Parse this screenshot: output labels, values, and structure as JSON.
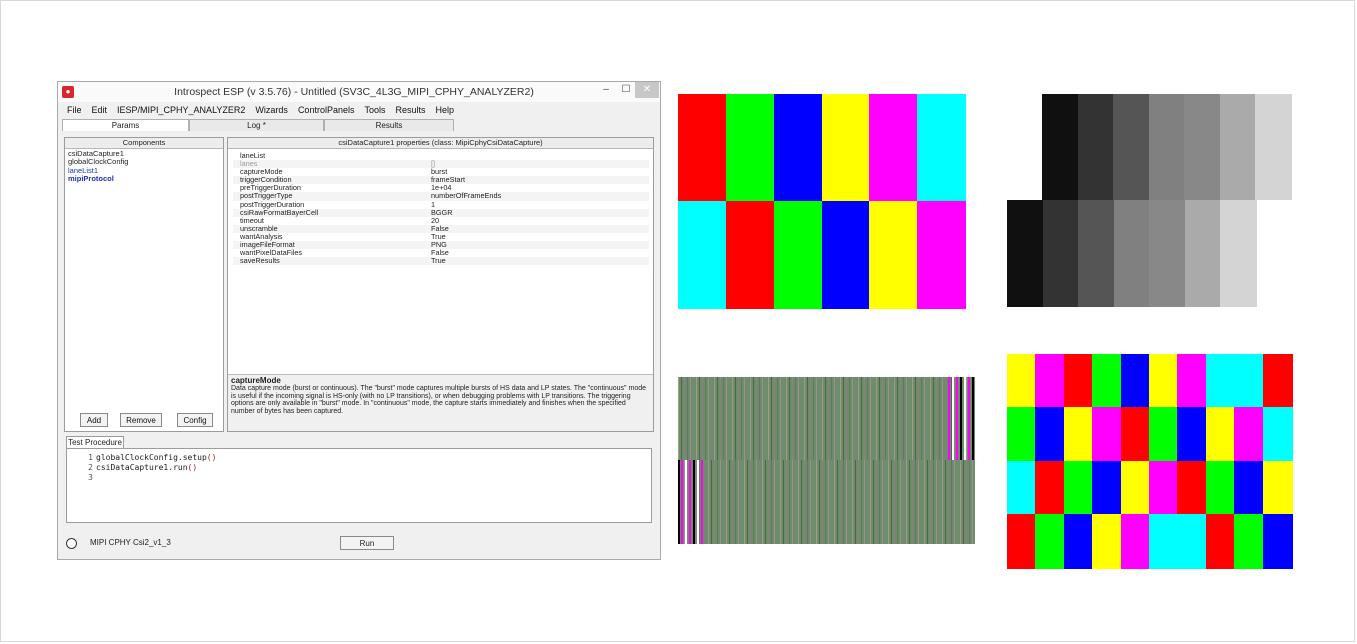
{
  "window": {
    "title": "Introspect ESP (v 3.5.76) - Untitled (SV3C_4L3G_MIPI_CPHY_ANALYZER2)",
    "controls": {
      "minimize": "–",
      "maximize": "☐",
      "close": "✕"
    }
  },
  "menu": [
    "File",
    "Edit",
    "IESP/MIPI_CPHY_ANALYZER2",
    "Wizards",
    "ControlPanels",
    "Tools",
    "Results",
    "Help"
  ],
  "tabs": [
    "Params",
    "Log *",
    "Results"
  ],
  "components": {
    "header": "Components",
    "items": [
      "csiDataCapture1",
      "globalClockConfig",
      "laneList1",
      "mipiProtocol"
    ],
    "buttons": {
      "add": "Add",
      "remove": "Remove",
      "config": "Config"
    }
  },
  "properties": {
    "header": "csiDataCapture1 properties (class: MipiCphyCsiDataCapture)",
    "rows": [
      {
        "name": "laneList",
        "value": ""
      },
      {
        "name": "lanes",
        "value": "[]"
      },
      {
        "name": "captureMode",
        "value": "burst"
      },
      {
        "name": "triggerCondition",
        "value": "frameStart"
      },
      {
        "name": "preTriggerDuration",
        "value": "1e+04"
      },
      {
        "name": "postTriggerType",
        "value": "numberOfFrameEnds"
      },
      {
        "name": "postTriggerDuration",
        "value": "1"
      },
      {
        "name": "csiRawFormatBayerCell",
        "value": "BGGR"
      },
      {
        "name": "timeout",
        "value": "20"
      },
      {
        "name": "unscramble",
        "value": "False"
      },
      {
        "name": "wantAnalysis",
        "value": "True"
      },
      {
        "name": "imageFileFormat",
        "value": "PNG"
      },
      {
        "name": "wantPixelDataFiles",
        "value": "False"
      },
      {
        "name": "saveResults",
        "value": "True"
      }
    ],
    "description_title": "captureMode",
    "description": "Data capture mode (burst or continuous). The \"burst\" mode captures multiple bursts of HS data and LP states. The \"continuous\" mode is useful if the incoming signal is HS-only (with no LP transitions), or when debugging problems with LP transitions. The triggering options are only available in \"burst\" mode. In \"continuous\" mode, the capture starts immediately and finishes when the specified number of bytes has been captured."
  },
  "procedure": {
    "tab": "Test Procedure",
    "lines": [
      {
        "num": "1",
        "obj": "globalClockConfig.setup",
        "paren": "()"
      },
      {
        "num": "2",
        "obj": "csiDataCapture1.run",
        "paren": "()"
      },
      {
        "num": "3",
        "obj": "",
        "paren": ""
      }
    ]
  },
  "status": {
    "label": "MIPI CPHY Csi2_v1_3",
    "run": "Run"
  },
  "patterns": {
    "colorbars": {
      "top": [
        "#ff0000",
        "#00ff00",
        "#0000ff",
        "#ffff00",
        "#ff00ff",
        "#00ffff"
      ],
      "bottom": [
        "#00ffff",
        "#ff0000",
        "#00ff00",
        "#0000ff",
        "#ffff00",
        "#ff00ff"
      ]
    },
    "graybars": {
      "top": [
        "#101010",
        "#333333",
        "#555555",
        "#808080",
        "#888888",
        "#aaaaaa",
        "#d4d4d4"
      ],
      "bottom": [
        "#101010",
        "#333333",
        "#555555",
        "#808080",
        "#888888",
        "#aaaaaa",
        "#d4d4d4"
      ]
    },
    "checker": [
      [
        "#ffff00",
        "#ff00ff",
        "#ff0000",
        "#00ff00",
        "#0000ff",
        "#ffff00",
        "#ff00ff",
        "#00ffff",
        "#00ffff",
        "#ff0000"
      ],
      [
        "#00ff00",
        "#0000ff",
        "#ffff00",
        "#ff00ff",
        "#ff0000",
        "#00ff00",
        "#0000ff",
        "#ffff00",
        "#ff00ff",
        "#00ffff"
      ],
      [
        "#00ffff",
        "#ff0000",
        "#00ff00",
        "#0000ff",
        "#ffff00",
        "#ff00ff",
        "#ff0000",
        "#00ff00",
        "#0000ff",
        "#ffff00"
      ],
      [
        "#ff0000",
        "#00ff00",
        "#0000ff",
        "#ffff00",
        "#ff00ff",
        "#00ffff",
        "#00ffff",
        "#ff0000",
        "#00ff00",
        "#0000ff"
      ]
    ]
  }
}
